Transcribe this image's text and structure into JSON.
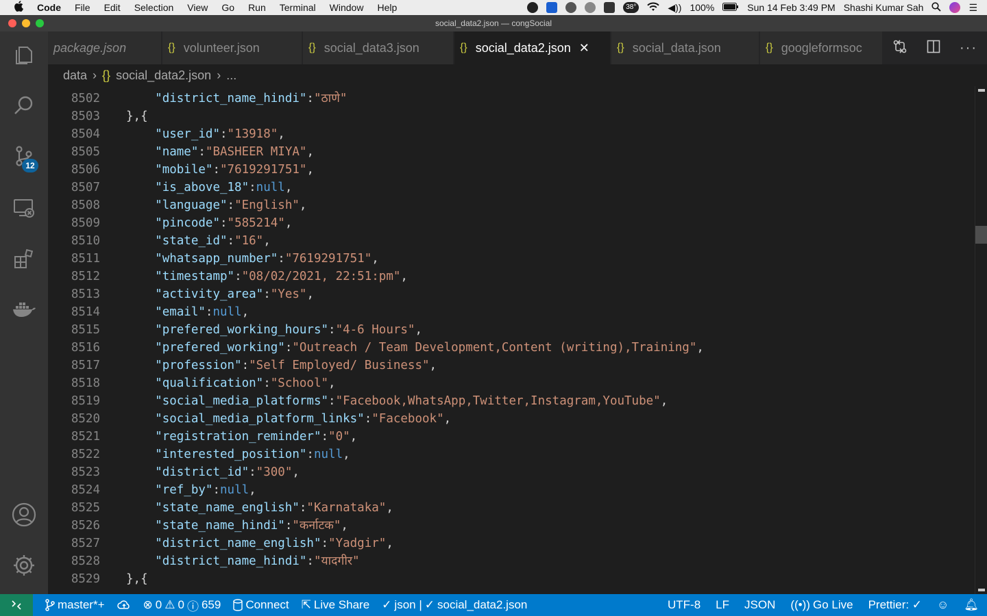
{
  "menubar": {
    "app_name": "Code",
    "items": [
      "File",
      "Edit",
      "Selection",
      "View",
      "Go",
      "Run",
      "Terminal",
      "Window",
      "Help"
    ],
    "temperature": "38°",
    "battery": "100%",
    "datetime": "Sun 14 Feb  3:49 PM",
    "user": "Shashi Kumar Sah"
  },
  "window": {
    "title": "social_data2.json — congSocial"
  },
  "activity_bar": {
    "source_control_badge": "12"
  },
  "tabs": [
    {
      "label": "package.json",
      "icon": "",
      "italic": true,
      "active": false
    },
    {
      "label": "volunteer.json",
      "icon": "{}",
      "italic": false,
      "active": false
    },
    {
      "label": "social_data3.json",
      "icon": "{}",
      "italic": false,
      "active": false
    },
    {
      "label": "social_data2.json",
      "icon": "{}",
      "italic": false,
      "active": true
    },
    {
      "label": "social_data.json",
      "icon": "{}",
      "italic": false,
      "active": false
    },
    {
      "label": "googleformsoc",
      "icon": "{}",
      "italic": false,
      "active": false
    }
  ],
  "breadcrumb": {
    "folder": "data",
    "file": "social_data2.json",
    "symbol": "..."
  },
  "editor": {
    "lines": [
      {
        "no": "8502",
        "indent": "    ",
        "key": "\"district_name_hindi\"",
        "value": "\"ठाणे\"",
        "type": "s",
        "comma": ""
      },
      {
        "no": "8503",
        "indent": "",
        "key": "",
        "value": "},{",
        "type": "p",
        "comma": ""
      },
      {
        "no": "8504",
        "indent": "    ",
        "key": "\"user_id\"",
        "value": "\"13918\"",
        "type": "s",
        "comma": ","
      },
      {
        "no": "8505",
        "indent": "    ",
        "key": "\"name\"",
        "value": "\"BASHEER MIYA\"",
        "type": "s",
        "comma": ","
      },
      {
        "no": "8506",
        "indent": "    ",
        "key": "\"mobile\"",
        "value": "\"7619291751\"",
        "type": "s",
        "comma": ","
      },
      {
        "no": "8507",
        "indent": "    ",
        "key": "\"is_above_18\"",
        "value": "null",
        "type": "n",
        "comma": ","
      },
      {
        "no": "8508",
        "indent": "    ",
        "key": "\"language\"",
        "value": "\"English\"",
        "type": "s",
        "comma": ","
      },
      {
        "no": "8509",
        "indent": "    ",
        "key": "\"pincode\"",
        "value": "\"585214\"",
        "type": "s",
        "comma": ","
      },
      {
        "no": "8510",
        "indent": "    ",
        "key": "\"state_id\"",
        "value": "\"16\"",
        "type": "s",
        "comma": ","
      },
      {
        "no": "8511",
        "indent": "    ",
        "key": "\"whatsapp_number\"",
        "value": "\"7619291751\"",
        "type": "s",
        "comma": ","
      },
      {
        "no": "8512",
        "indent": "    ",
        "key": "\"timestamp\"",
        "value": "\"08/02/2021, 22:51:pm\"",
        "type": "s",
        "comma": ","
      },
      {
        "no": "8513",
        "indent": "    ",
        "key": "\"activity_area\"",
        "value": "\"Yes\"",
        "type": "s",
        "comma": ","
      },
      {
        "no": "8514",
        "indent": "    ",
        "key": "\"email\"",
        "value": "null",
        "type": "n",
        "comma": ","
      },
      {
        "no": "8515",
        "indent": "    ",
        "key": "\"prefered_working_hours\"",
        "value": "\"4-6 Hours\"",
        "type": "s",
        "comma": ","
      },
      {
        "no": "8516",
        "indent": "    ",
        "key": "\"prefered_working\"",
        "value": "\"Outreach / Team Development,Content (writing),Training\"",
        "type": "s",
        "comma": ","
      },
      {
        "no": "8517",
        "indent": "    ",
        "key": "\"profession\"",
        "value": "\"Self Employed/ Business\"",
        "type": "s",
        "comma": ","
      },
      {
        "no": "8518",
        "indent": "    ",
        "key": "\"qualification\"",
        "value": "\"School\"",
        "type": "s",
        "comma": ","
      },
      {
        "no": "8519",
        "indent": "    ",
        "key": "\"social_media_platforms\"",
        "value": "\"Facebook,WhatsApp,Twitter,Instagram,YouTube\"",
        "type": "s",
        "comma": ","
      },
      {
        "no": "8520",
        "indent": "    ",
        "key": "\"social_media_platform_links\"",
        "value": "\"Facebook\"",
        "type": "s",
        "comma": ","
      },
      {
        "no": "8521",
        "indent": "    ",
        "key": "\"registration_reminder\"",
        "value": "\"0\"",
        "type": "s",
        "comma": ","
      },
      {
        "no": "8522",
        "indent": "    ",
        "key": "\"interested_position\"",
        "value": "null",
        "type": "n",
        "comma": ","
      },
      {
        "no": "8523",
        "indent": "    ",
        "key": "\"district_id\"",
        "value": "\"300\"",
        "type": "s",
        "comma": ","
      },
      {
        "no": "8524",
        "indent": "    ",
        "key": "\"ref_by\"",
        "value": "null",
        "type": "n",
        "comma": ","
      },
      {
        "no": "8525",
        "indent": "    ",
        "key": "\"state_name_english\"",
        "value": "\"Karnataka\"",
        "type": "s",
        "comma": ","
      },
      {
        "no": "8526",
        "indent": "    ",
        "key": "\"state_name_hindi\"",
        "value": "\"कर्नाटक\"",
        "type": "s",
        "comma": ","
      },
      {
        "no": "8527",
        "indent": "    ",
        "key": "\"district_name_english\"",
        "value": "\"Yadgir\"",
        "type": "s",
        "comma": ","
      },
      {
        "no": "8528",
        "indent": "    ",
        "key": "\"district_name_hindi\"",
        "value": "\"यादगीर\"",
        "type": "s",
        "comma": ""
      },
      {
        "no": "8529",
        "indent": "",
        "key": "",
        "value": "},{",
        "type": "p",
        "comma": ""
      }
    ]
  },
  "statusbar": {
    "branch": "master*+",
    "errors": "0",
    "warnings": "0",
    "info": "659",
    "connect": "Connect",
    "live_share": "Live Share",
    "json_check": "json |",
    "file_check": "social_data2.json",
    "encoding": "UTF-8",
    "eol": "LF",
    "language": "JSON",
    "go_live": "Go Live",
    "prettier": "Prettier: ✓"
  },
  "colors": {
    "key": "#9cdcfe",
    "string": "#ce9178",
    "null": "#569cd6",
    "status_bar": "#007acc",
    "remote": "#16825d"
  }
}
